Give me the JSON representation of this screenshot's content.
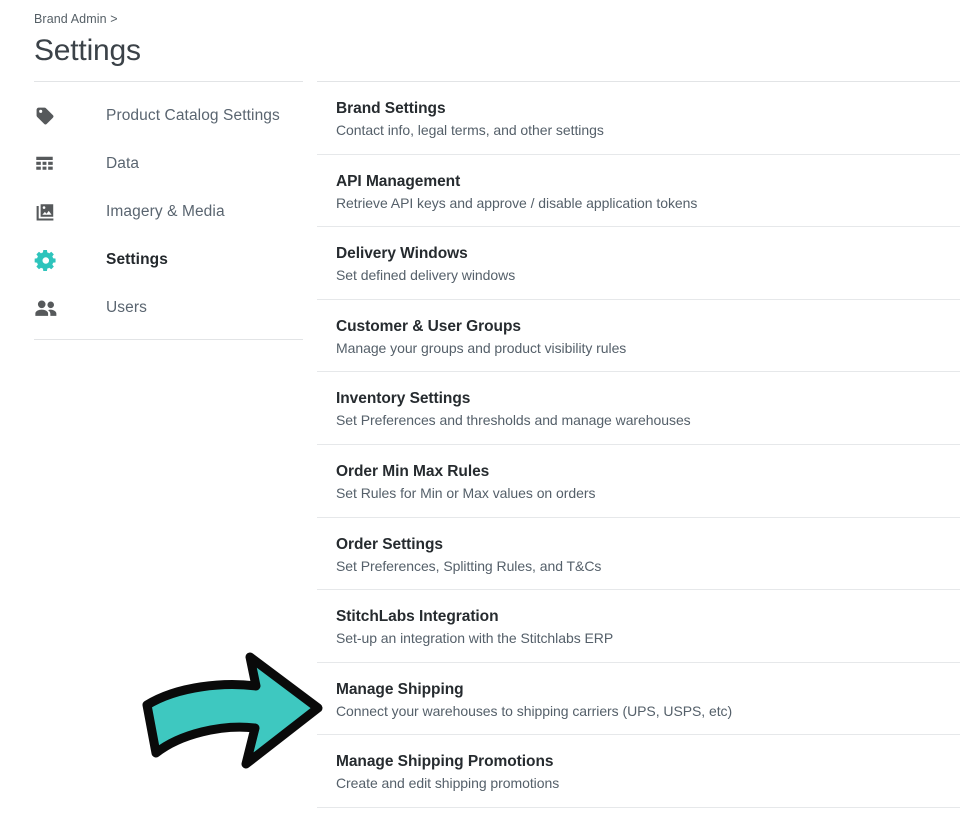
{
  "header": {
    "breadcrumb": "Brand Admin >",
    "title": "Settings"
  },
  "sidebar": {
    "items": [
      {
        "label": "Product Catalog Settings",
        "icon": "tag-icon",
        "active": false
      },
      {
        "label": "Data",
        "icon": "table-grid-icon",
        "active": false
      },
      {
        "label": "Imagery & Media",
        "icon": "image-icon",
        "active": false
      },
      {
        "label": "Settings",
        "icon": "gear-icon",
        "active": true
      },
      {
        "label": "Users",
        "icon": "users-icon",
        "active": false
      }
    ]
  },
  "main": {
    "rows": [
      {
        "title": "Brand Settings",
        "desc": "Contact info, legal terms, and other settings"
      },
      {
        "title": "API Management",
        "desc": "Retrieve API keys and approve / disable application tokens"
      },
      {
        "title": "Delivery Windows",
        "desc": "Set defined delivery windows"
      },
      {
        "title": "Customer & User Groups",
        "desc": "Manage your groups and product visibility rules"
      },
      {
        "title": "Inventory Settings",
        "desc": "Set Preferences and thresholds and manage warehouses"
      },
      {
        "title": "Order Min Max Rules",
        "desc": "Set Rules for Min or Max values on orders"
      },
      {
        "title": "Order Settings",
        "desc": "Set Preferences, Splitting Rules, and T&Cs"
      },
      {
        "title": "StitchLabs Integration",
        "desc": "Set-up an integration with the Stitchlabs ERP"
      },
      {
        "title": "Manage Shipping",
        "desc": "Connect your warehouses to shipping carriers (UPS, USPS, etc)"
      },
      {
        "title": "Manage Shipping Promotions",
        "desc": "Create and edit shipping promotions"
      }
    ]
  },
  "annotation": {
    "type": "arrow-pointing-right",
    "points_at": "Manage Shipping",
    "fill_color": "#3ec8c0",
    "outline_color": "#0a0a0a"
  },
  "colors": {
    "accent_teal": "#2ec4bc",
    "title_text": "#3b4248",
    "body_text": "#55606a",
    "divider": "#e2e4e6"
  }
}
